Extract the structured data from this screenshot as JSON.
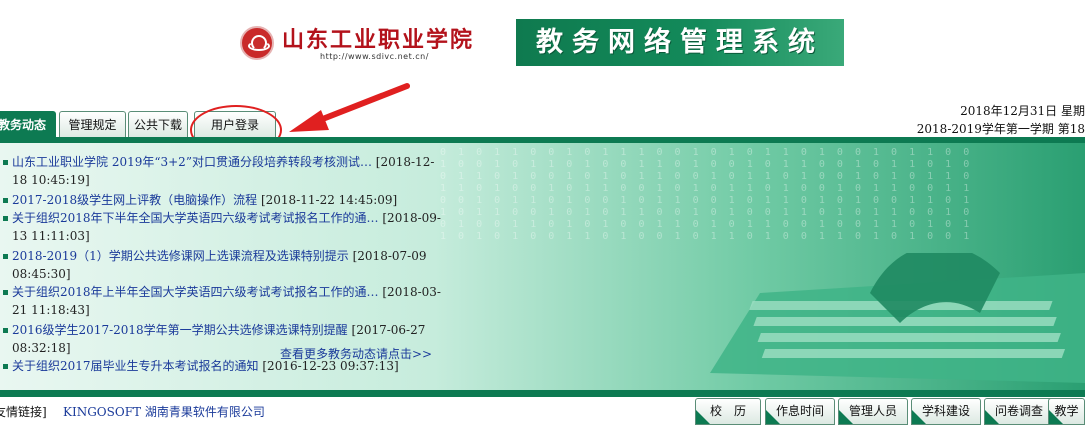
{
  "header": {
    "school_name": "山东工业职业学院",
    "school_url": "http://www.sdivc.net.cn/",
    "system_title": "教务网络管理系统"
  },
  "nav": {
    "tabs": [
      {
        "label": "教务动态",
        "active": true
      },
      {
        "label": "管理规定"
      },
      {
        "label": "公共下载"
      },
      {
        "label": "用户登录"
      }
    ]
  },
  "date_info": {
    "date": "2018年12月31日  星期",
    "term": "2018-2019学年第一学期  第18"
  },
  "news": [
    {
      "title": "山东工业职业学院 2019年“3+2”对口贯通分段培养转段考核测试…",
      "date": "[2018-12-18 10:45:19]"
    },
    {
      "title": "2017-2018级学生网上评教（电脑操作）流程",
      "date": "[2018-11-22 14:45:09]"
    },
    {
      "title": "关于组织2018年下半年全国大学英语四六级考试考试报名工作的通…",
      "date": "[2018-09-13 11:11:03]"
    },
    {
      "title": "2018-2019（1）学期公共选修课网上选课流程及选课特别提示",
      "date": "[2018-07-09 08:45:30]"
    },
    {
      "title": "关于组织2018年上半年全国大学英语四六级考试考试报名工作的通…",
      "date": "[2018-03-21 11:18:43]"
    },
    {
      "title": "2016级学生2017-2018学年第一学期公共选修课选课特别提醒",
      "date": "[2017-06-27 08:32:18]"
    },
    {
      "title": "关于组织2017届毕业生专升本考试报名的通知",
      "date": "[2016-12-23 09:37:13]"
    }
  ],
  "more_link": "查看更多教务动态请点击>>",
  "footer": {
    "friend_label": "友情链接]",
    "friend_link": "KINGOSOFT  湖南青果软件有限公司",
    "tabs": [
      "校　历",
      "作息时间",
      "管理人员",
      "学科建设",
      "问卷调查",
      "教学"
    ]
  },
  "colors": {
    "brand_green": "#0d7a52",
    "school_red": "#b3121b",
    "link_blue": "#1a3a9a",
    "annotation_red": "#e02020"
  }
}
